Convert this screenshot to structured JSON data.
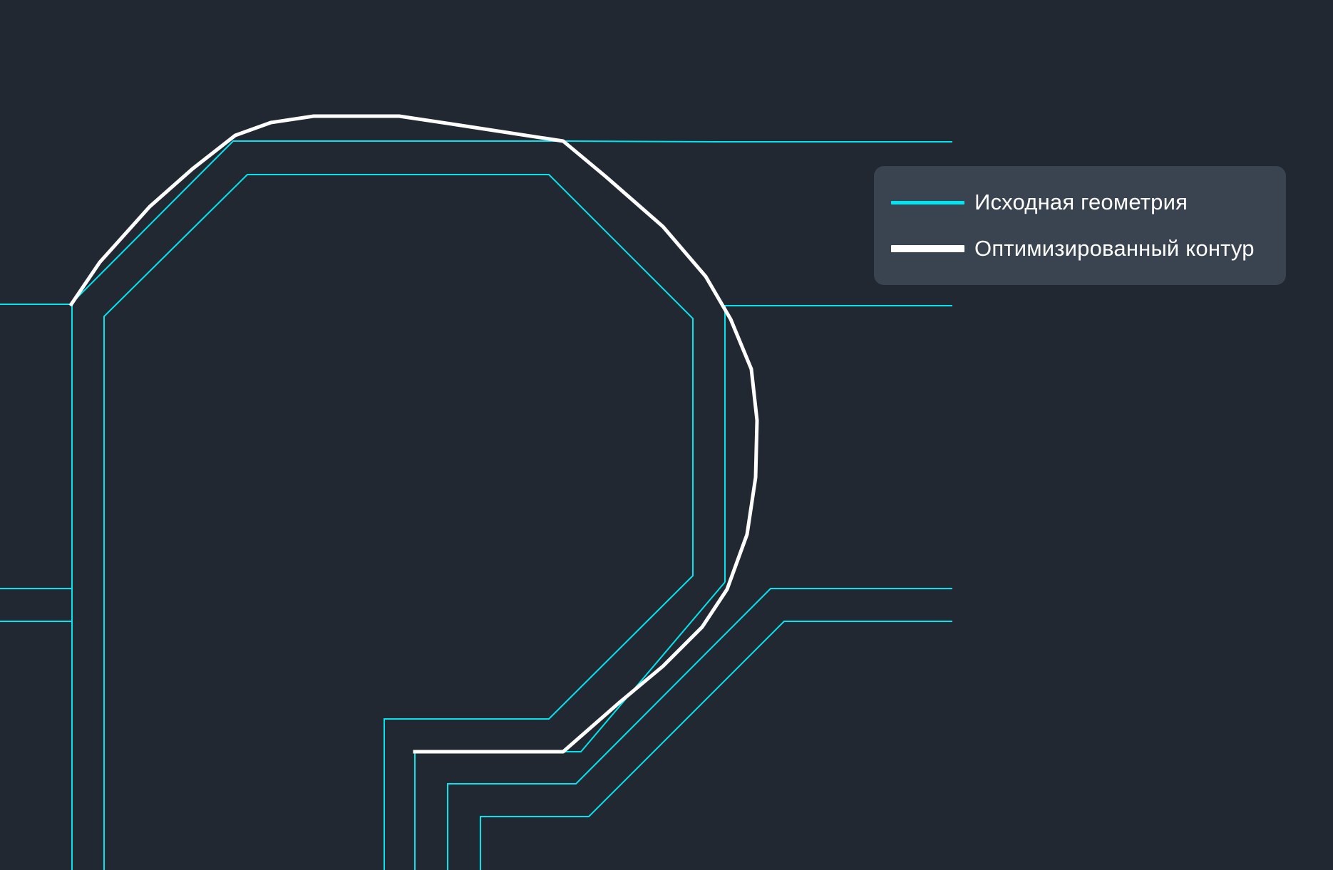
{
  "colors": {
    "background": "#212831",
    "source_geometry": "#00e5f0",
    "optimized_contour": "#ffffff",
    "legend_background": "#3a4451"
  },
  "legend": {
    "items": [
      {
        "label": "Исходная геометрия",
        "style": "thin",
        "color": "#00e5f0"
      },
      {
        "label": "Оптимизированный контур",
        "style": "thick",
        "color": "#ffffff"
      }
    ]
  }
}
